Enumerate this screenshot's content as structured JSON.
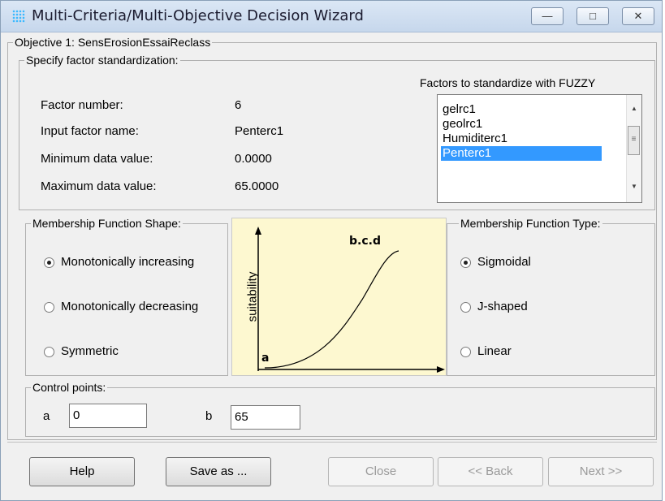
{
  "window": {
    "title": "Multi-Criteria/Multi-Objective Decision Wizard",
    "controls": {
      "minimize": "—",
      "maximize": "□",
      "close": "✕"
    }
  },
  "objective": {
    "legend": "Objective 1: SensErosionEssaiReclass"
  },
  "standardization": {
    "legend": "Specify factor standardization:",
    "fields": [
      {
        "label": "Factor number:",
        "value": "6"
      },
      {
        "label": "Input factor name:",
        "value": "Penterc1"
      },
      {
        "label": "Minimum data value:",
        "value": "0.0000"
      },
      {
        "label": "Maximum data value:",
        "value": "65.0000"
      }
    ],
    "list_title": "Factors to standardize with FUZZY",
    "list_items": [
      "gelrc1",
      "geolrc1",
      "Humiditerc1",
      "Penterc1"
    ],
    "selected_item": "Penterc1"
  },
  "shape": {
    "legend": "Membership Function Shape:",
    "options": [
      {
        "label": "Monotonically increasing",
        "checked": true
      },
      {
        "label": "Monotonically decreasing",
        "checked": false
      },
      {
        "label": "Symmetric",
        "checked": false
      }
    ]
  },
  "plot": {
    "ylabel": "suitability",
    "point_a": "a",
    "point_bcd": "b.c.d"
  },
  "type": {
    "legend": "Membership Function Type:",
    "options": [
      {
        "label": "Sigmoidal",
        "checked": true
      },
      {
        "label": "J-shaped",
        "checked": false
      },
      {
        "label": "Linear",
        "checked": false
      }
    ]
  },
  "control_points": {
    "legend": "Control points:",
    "a_label": "a",
    "a_value": "0",
    "b_label": "b",
    "b_value": "65"
  },
  "buttons": {
    "help": "Help",
    "save_as": "Save as ...",
    "close": "Close",
    "back": "<< Back",
    "next": "Next >>"
  },
  "colors": {
    "selection": "#3399ff",
    "plot_background": "#fdf8d0"
  }
}
